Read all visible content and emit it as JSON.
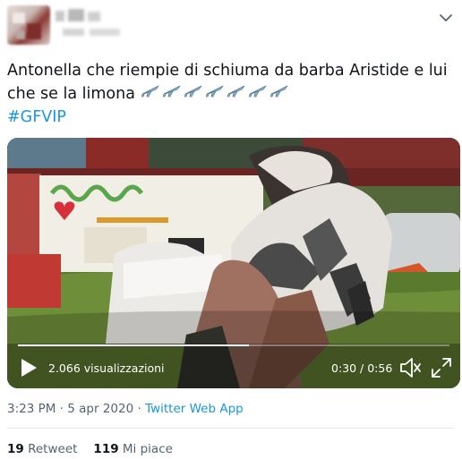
{
  "tweet": {
    "text": "Antonella che riempie di schiuma da barba Aristide e lui che se la limona",
    "emoji_count": 7,
    "emoji_icon": "airplane-icon",
    "hashtag": "#GFVIP"
  },
  "video": {
    "views": "2.066 visualizzazioni",
    "time": "0:30 / 0:56",
    "progress": 0.536
  },
  "meta": {
    "timestamp": "3:23 PM · 5 apr 2020 · ",
    "source": "Twitter Web App"
  },
  "stats": {
    "retweets_count": "19",
    "retweets_label": "Retweet",
    "likes_count": "119",
    "likes_label": "Mi piace"
  },
  "colors": {
    "link": "#1b95e0",
    "text": "#0f1419",
    "muted": "#536471"
  }
}
